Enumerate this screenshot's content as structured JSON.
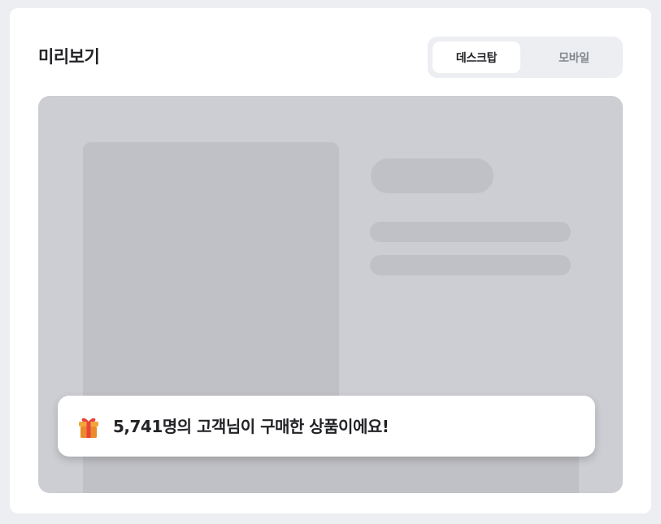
{
  "header": {
    "title": "미리보기"
  },
  "view_toggle": {
    "options": [
      "데스크탑",
      "모바일"
    ],
    "selected": "데스크탑"
  },
  "preview": {
    "toast": {
      "icon": "gift-icon",
      "message": "5,741명의 고객님이 구매한 상품이에요!"
    }
  },
  "colors": {
    "page_background": "#eceef2",
    "preview_background": "#cdced3",
    "placeholder": "#c0c1c6",
    "text_primary": "#222326",
    "text_muted": "#83878e"
  }
}
